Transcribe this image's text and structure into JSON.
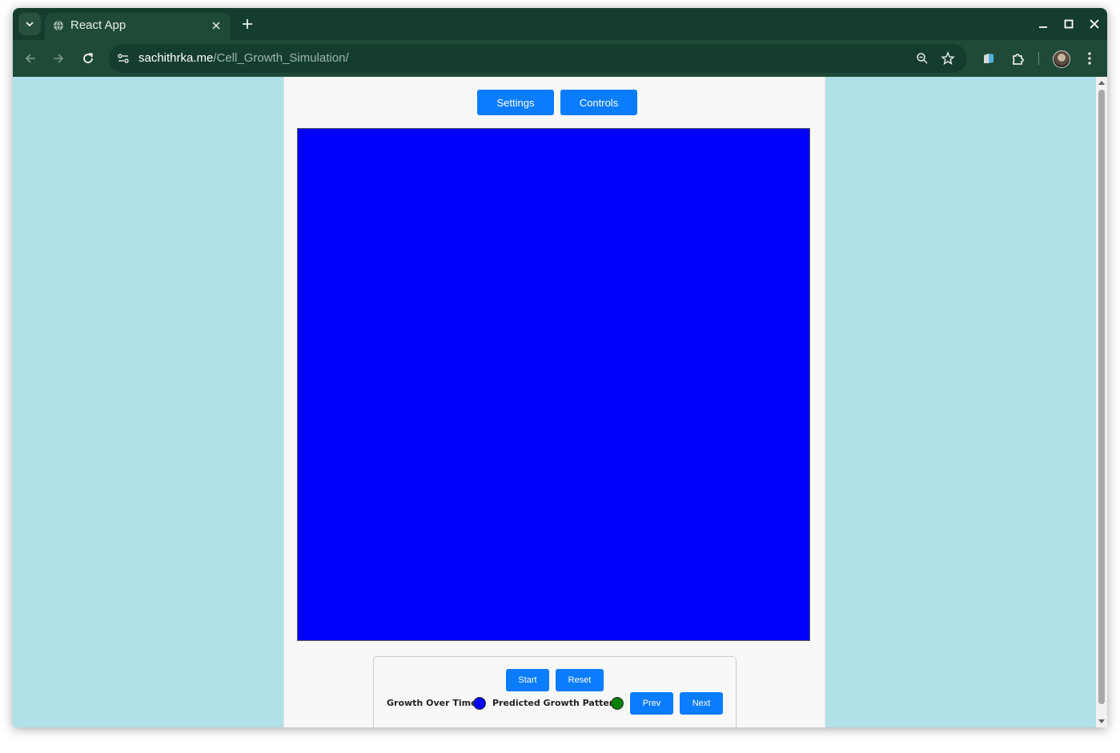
{
  "browser": {
    "tab_title": "React App",
    "url_host": "sachithrka.me",
    "url_path": "/Cell_Growth_Simulation/"
  },
  "app": {
    "top_buttons": {
      "settings": "Settings",
      "controls": "Controls"
    },
    "canvas_color": "#0000ff",
    "panel": {
      "start": "Start",
      "reset": "Reset",
      "growth_label": "Growth Over Time:",
      "growth_color": "#0000ff",
      "predicted_label": "Predicted Growth Pattern:",
      "predicted_color": "#008000",
      "prev": "Prev",
      "next": "Next"
    }
  },
  "colors": {
    "page_background": "#b0e0e8",
    "button_blue": "#0a7cff",
    "browser_frame": "#153d2e"
  }
}
